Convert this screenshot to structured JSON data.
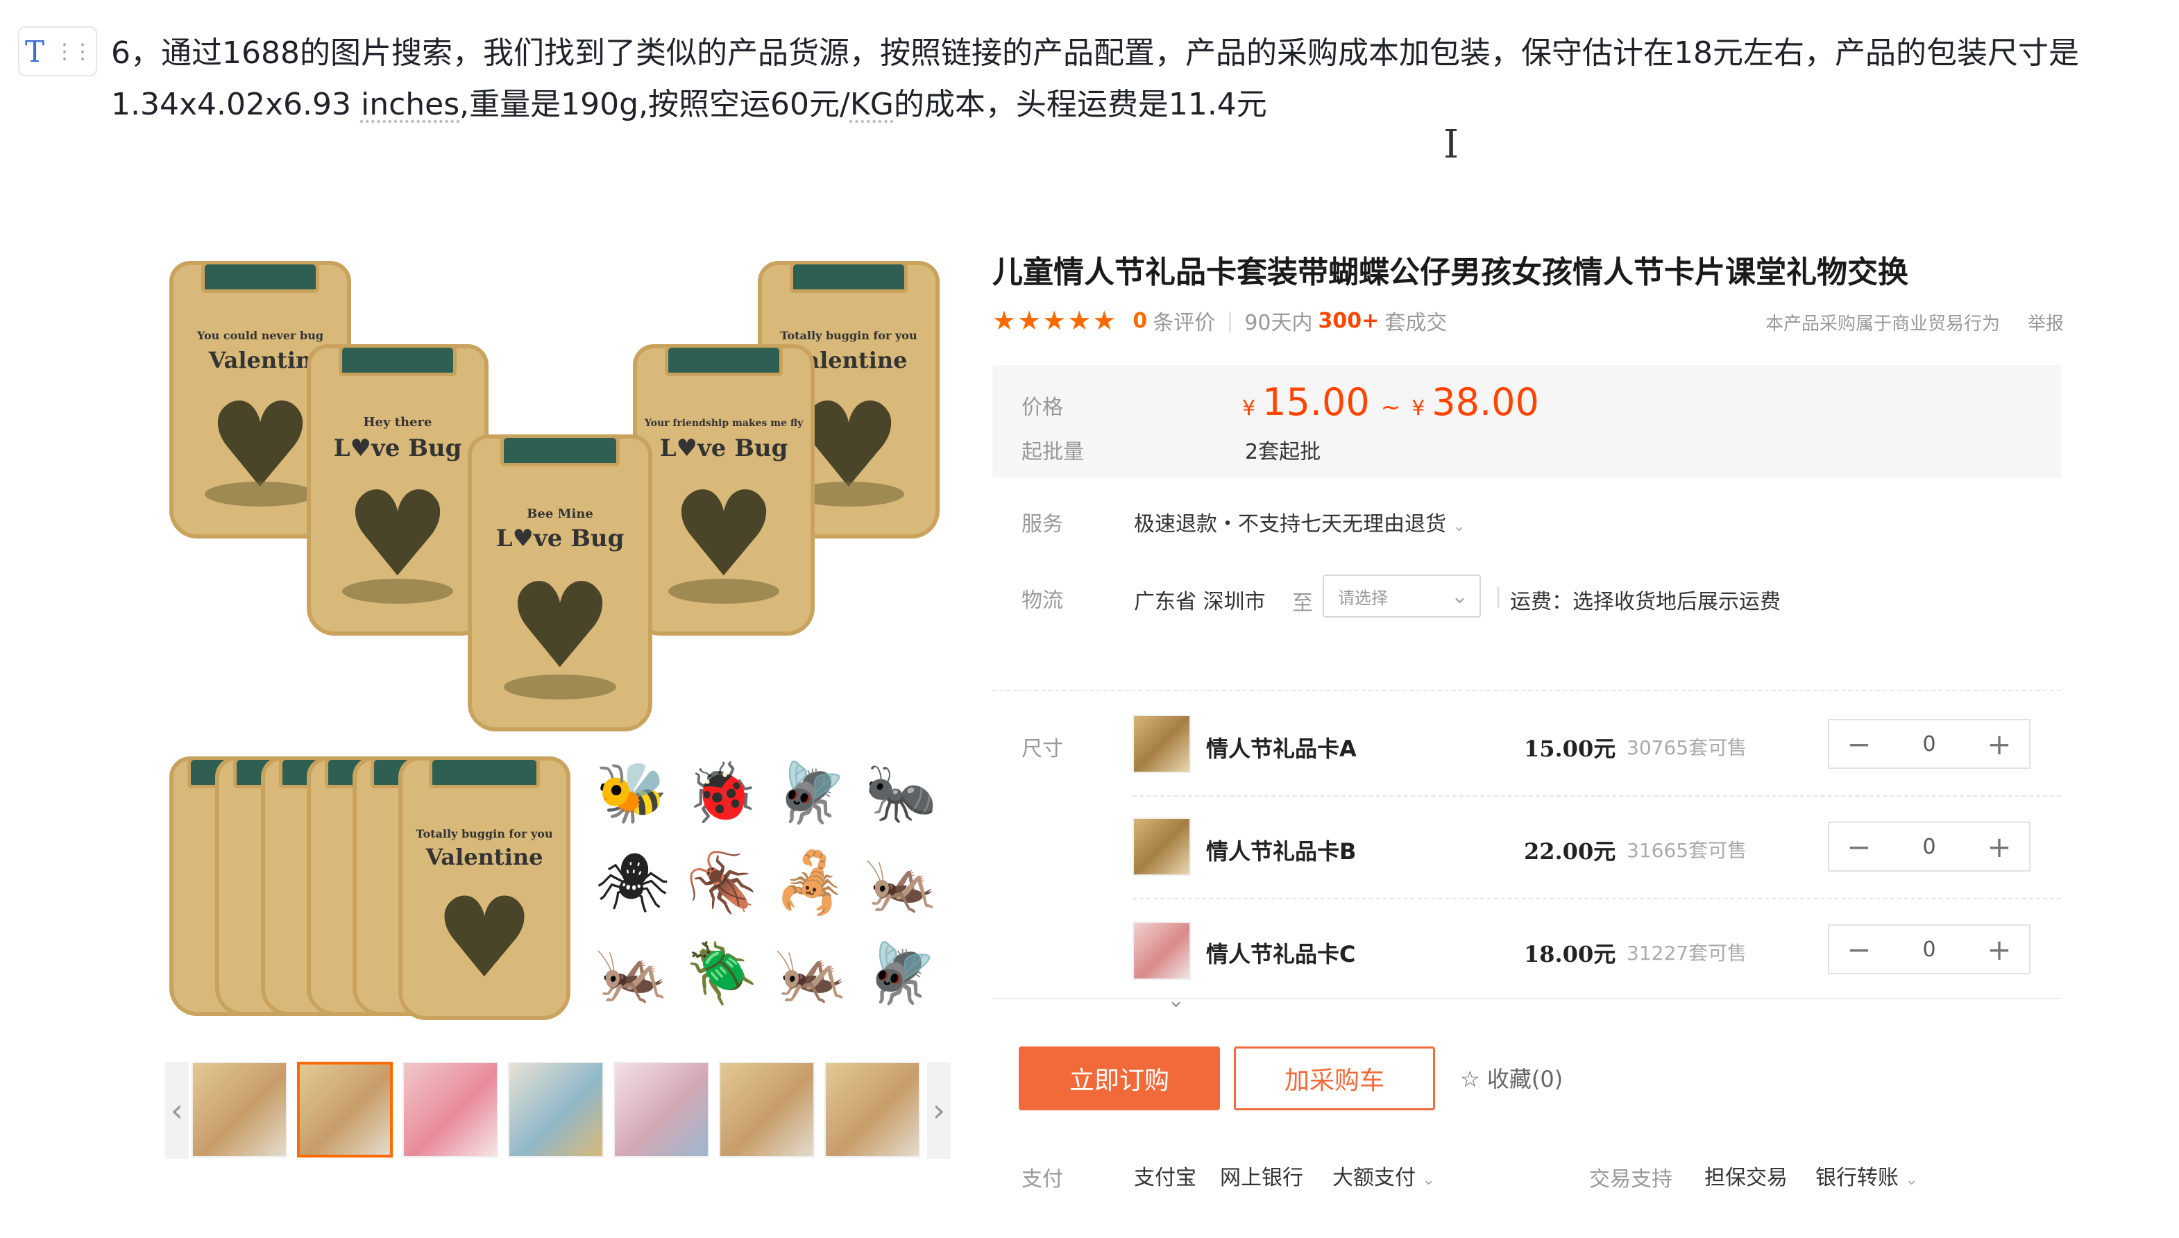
{
  "note": {
    "block_icon": "T",
    "text_part1": "6，通过1688的图片搜索，我们找到了类似的产品货源，按照链接的产品配置，产品的采购成本加包装，保守估计在18元左右，产品的包装尺寸是1.34x4.02x6.93 ",
    "text_inches": "inches",
    "text_part2": ",重量是190g,按照空运60元/",
    "text_kg": "KG",
    "text_part3": "的成本，头程运费是11.4元",
    "cursor_glyph": "I"
  },
  "gallery": {
    "jar_texts": {
      "top_left_small": "You could never bug",
      "top_left_big": "Valentin",
      "mid_left_small": "Hey there",
      "mid_left_big": "L♥ve Bug",
      "center_small": "Bee Mine",
      "center_big": "L♥ve Bug",
      "mid_right_small": "Your friendship makes me fly",
      "mid_right_big": "L♥ve Bug",
      "top_right_small": "Totally buggin for you",
      "top_right_big": "Valentine",
      "bottom_small": "Totally buggin for you",
      "bottom_big": "Valentine"
    },
    "prev_arrow": "‹",
    "next_arrow": "›",
    "thumbnails": [
      "jars",
      "jars-grid",
      "girl",
      "cards",
      "kids",
      "jars",
      "jars-grid"
    ],
    "active_thumbnail": 1
  },
  "product": {
    "title": "儿童情人节礼品卡套装带蝴蝶公仔男孩女孩情人节卡片课堂礼物交换",
    "stars": "★★★★★",
    "review_count": "0",
    "review_label": "条评价",
    "sold_prefix": "90天内",
    "sold_count": "300+",
    "sold_suffix": "套成交",
    "notice": "本产品采购属于商业贸易行为",
    "report": "举报",
    "price_label": "价格",
    "currency": "¥",
    "price_min": "15.00",
    "price_sep": "~",
    "price_max": "38.00",
    "moq_label": "起批量",
    "moq_value": "2套起批",
    "service_label": "服务",
    "service_value": "极速退款・不支持七天无理由退货",
    "logistics_label": "物流",
    "logistics_from": "广东省 深圳市",
    "logistics_to": "至",
    "logistics_select": "请选择",
    "shipping_text": "运费：选择收货地后展示运费",
    "size_label": "尺寸",
    "skus": [
      {
        "name": "情人节礼品卡A",
        "price": "15.00元",
        "stock": "30765套可售",
        "qty": "0"
      },
      {
        "name": "情人节礼品卡B",
        "price": "22.00元",
        "stock": "31665套可售",
        "qty": "0"
      },
      {
        "name": "情人节礼品卡C",
        "price": "18.00元",
        "stock": "31227套可售",
        "qty": "0"
      }
    ],
    "buy_now": "立即订购",
    "add_cart": "加采购车",
    "favorite": "收藏(0)",
    "pay_label": "支付",
    "pay_methods": [
      "支付宝",
      "网上银行",
      "大额支付"
    ],
    "trade_label": "交易支持",
    "trade_methods": [
      "担保交易",
      "银行转账"
    ]
  }
}
